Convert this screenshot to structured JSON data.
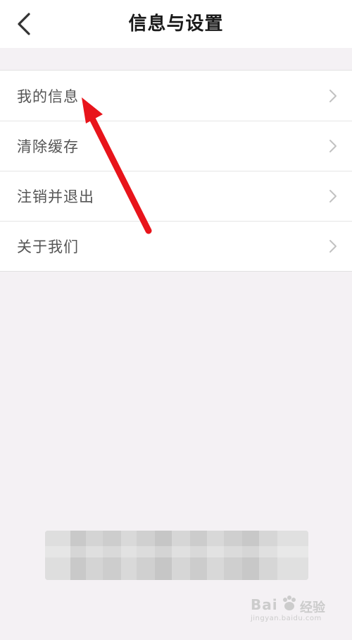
{
  "header": {
    "title": "信息与设置",
    "back_icon": "chevron-left-icon"
  },
  "menu": {
    "items": [
      {
        "label": "我的信息"
      },
      {
        "label": "清除缓存"
      },
      {
        "label": "注销并退出"
      },
      {
        "label": "关于我们"
      }
    ],
    "chevron_icon": "chevron-right-icon"
  },
  "annotation": {
    "arrow_color": "#e8141b"
  },
  "watermark": {
    "brand": "Bai",
    "icon": "paw-icon",
    "product": "经验",
    "url": "jingyan.baidu.com"
  },
  "colors": {
    "background": "#f4f1f4",
    "card": "#ffffff",
    "divider": "#e6e6e6",
    "label": "#555555",
    "title": "#1a1a1a"
  }
}
